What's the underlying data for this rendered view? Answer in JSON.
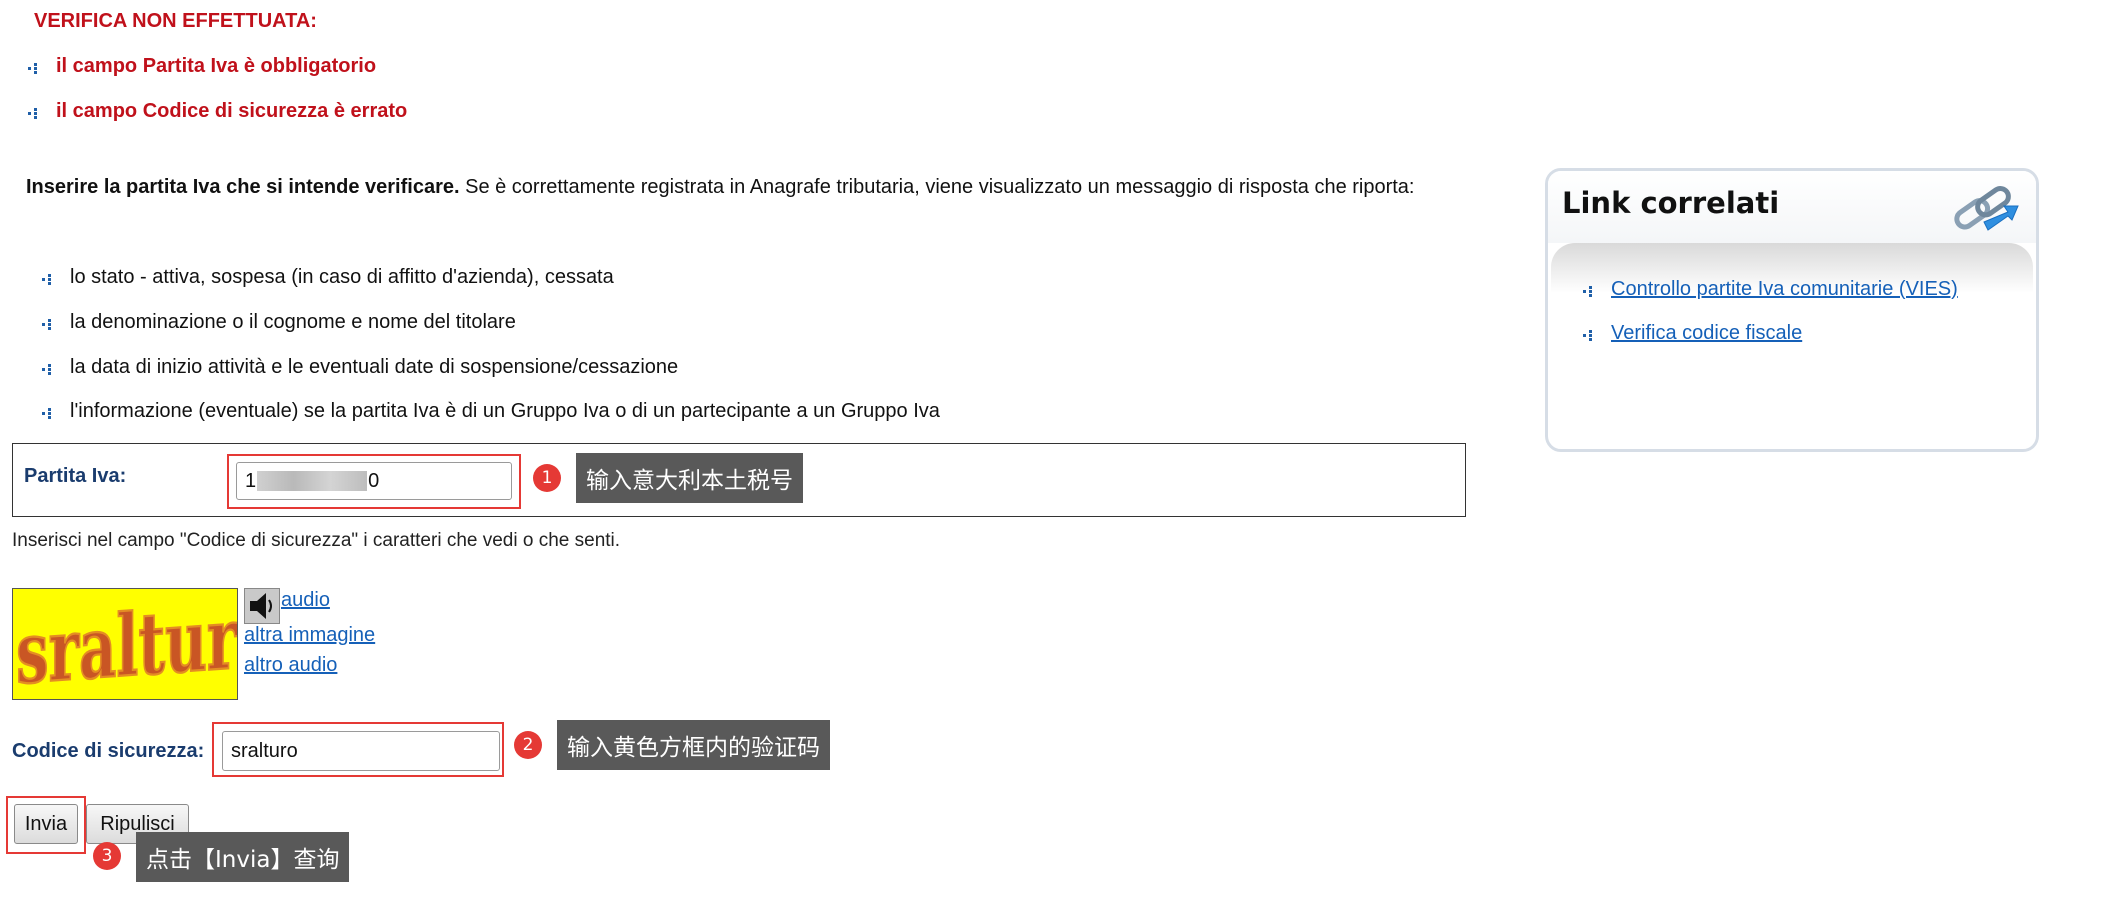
{
  "errors": {
    "title": "VERIFICA NON EFFETTUATA:",
    "items": [
      "il campo Partita Iva è obbligatorio",
      "il campo Codice di sicurezza è errato"
    ]
  },
  "intro": {
    "bold": "Inserire la partita Iva che si intende verificare.",
    "rest": " Se è correttamente registrata in Anagrafe tributaria, viene visualizzato un messaggio di risposta che riporta:"
  },
  "info_items": [
    "lo stato - attiva, sospesa (in caso di affitto d'azienda), cessata",
    "la denominazione o il cognome e nome del titolare",
    "la data di inizio attività e le eventuali date di sospensione/cessazione",
    "l'informazione (eventuale) se la partita Iva è di un Gruppo Iva o di un partecipante a un Gruppo Iva"
  ],
  "form": {
    "piva_label": "Partita Iva:",
    "piva_value_start": "1",
    "piva_value_end": "0",
    "hint": "Inserisci nel campo \"Codice di sicurezza\" i caratteri che vedi o che senti.",
    "captcha_text": "sralturo",
    "audio_link": "audio",
    "other_image_link": "altra immagine",
    "other_audio_link": "altro audio",
    "code_label": "Codice di sicurezza:",
    "code_value": "sralturo",
    "submit_label": "Invia",
    "reset_label": "Ripulisci"
  },
  "annotations": [
    {
      "number": "1",
      "text": "输入意大利本土税号"
    },
    {
      "number": "2",
      "text": "输入黄色方框内的验证码"
    },
    {
      "number": "3",
      "text": "点击【Invia】查询"
    }
  ],
  "sidebar": {
    "title": "Link correlati",
    "links": [
      "Controllo partite Iva comunitarie (VIES)",
      "Verifica codice fiscale"
    ]
  },
  "colors": {
    "error": "#c0111b",
    "label": "#1a3c6e",
    "link": "#1560b8",
    "annotation_red": "#e53935",
    "tooltip_bg": "#595959",
    "captcha_bg": "#ffff00"
  },
  "icons": [
    "blue-dot-bullet-icon",
    "speaker-icon",
    "chain-link-icon"
  ]
}
